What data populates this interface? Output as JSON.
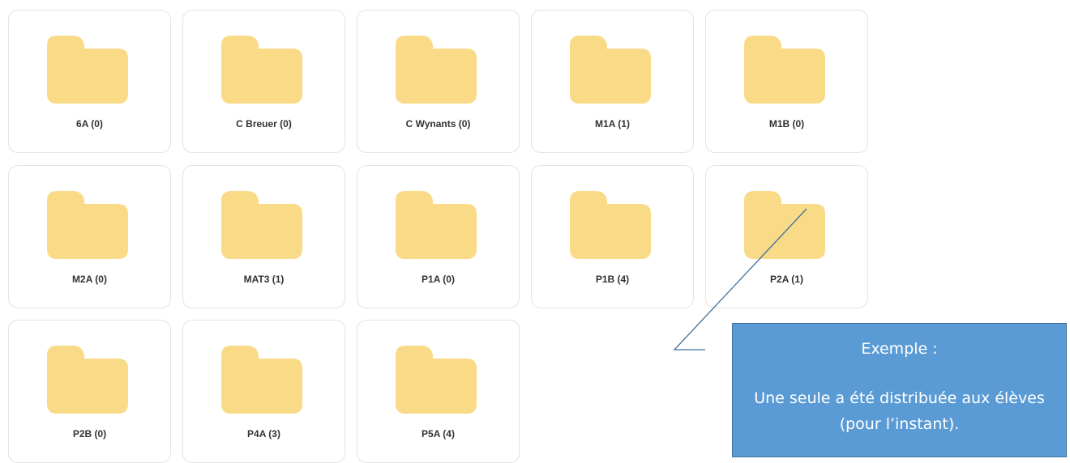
{
  "folders": [
    {
      "label": "6A (0)"
    },
    {
      "label": "C Breuer (0)"
    },
    {
      "label": "C Wynants (0)"
    },
    {
      "label": "M1A (1)"
    },
    {
      "label": "M1B (0)"
    },
    {
      "label": "M2A (0)"
    },
    {
      "label": "MAT3 (1)"
    },
    {
      "label": "P1A (0)"
    },
    {
      "label": "P1B (4)"
    },
    {
      "label": "P2A (1)"
    },
    {
      "label": "P2B (0)"
    },
    {
      "label": "P4A (3)"
    },
    {
      "label": "P5A (4)"
    }
  ],
  "callout": {
    "title": "Exemple :",
    "body": "Une seule a été distribuée aux élèves (pour l’instant)."
  },
  "colors": {
    "folder": "#f9da87",
    "callout_bg": "#5b9bd5",
    "callout_border": "#41719c",
    "pointer_line": "#41719c"
  },
  "icons": {
    "folder": "folder-icon"
  }
}
